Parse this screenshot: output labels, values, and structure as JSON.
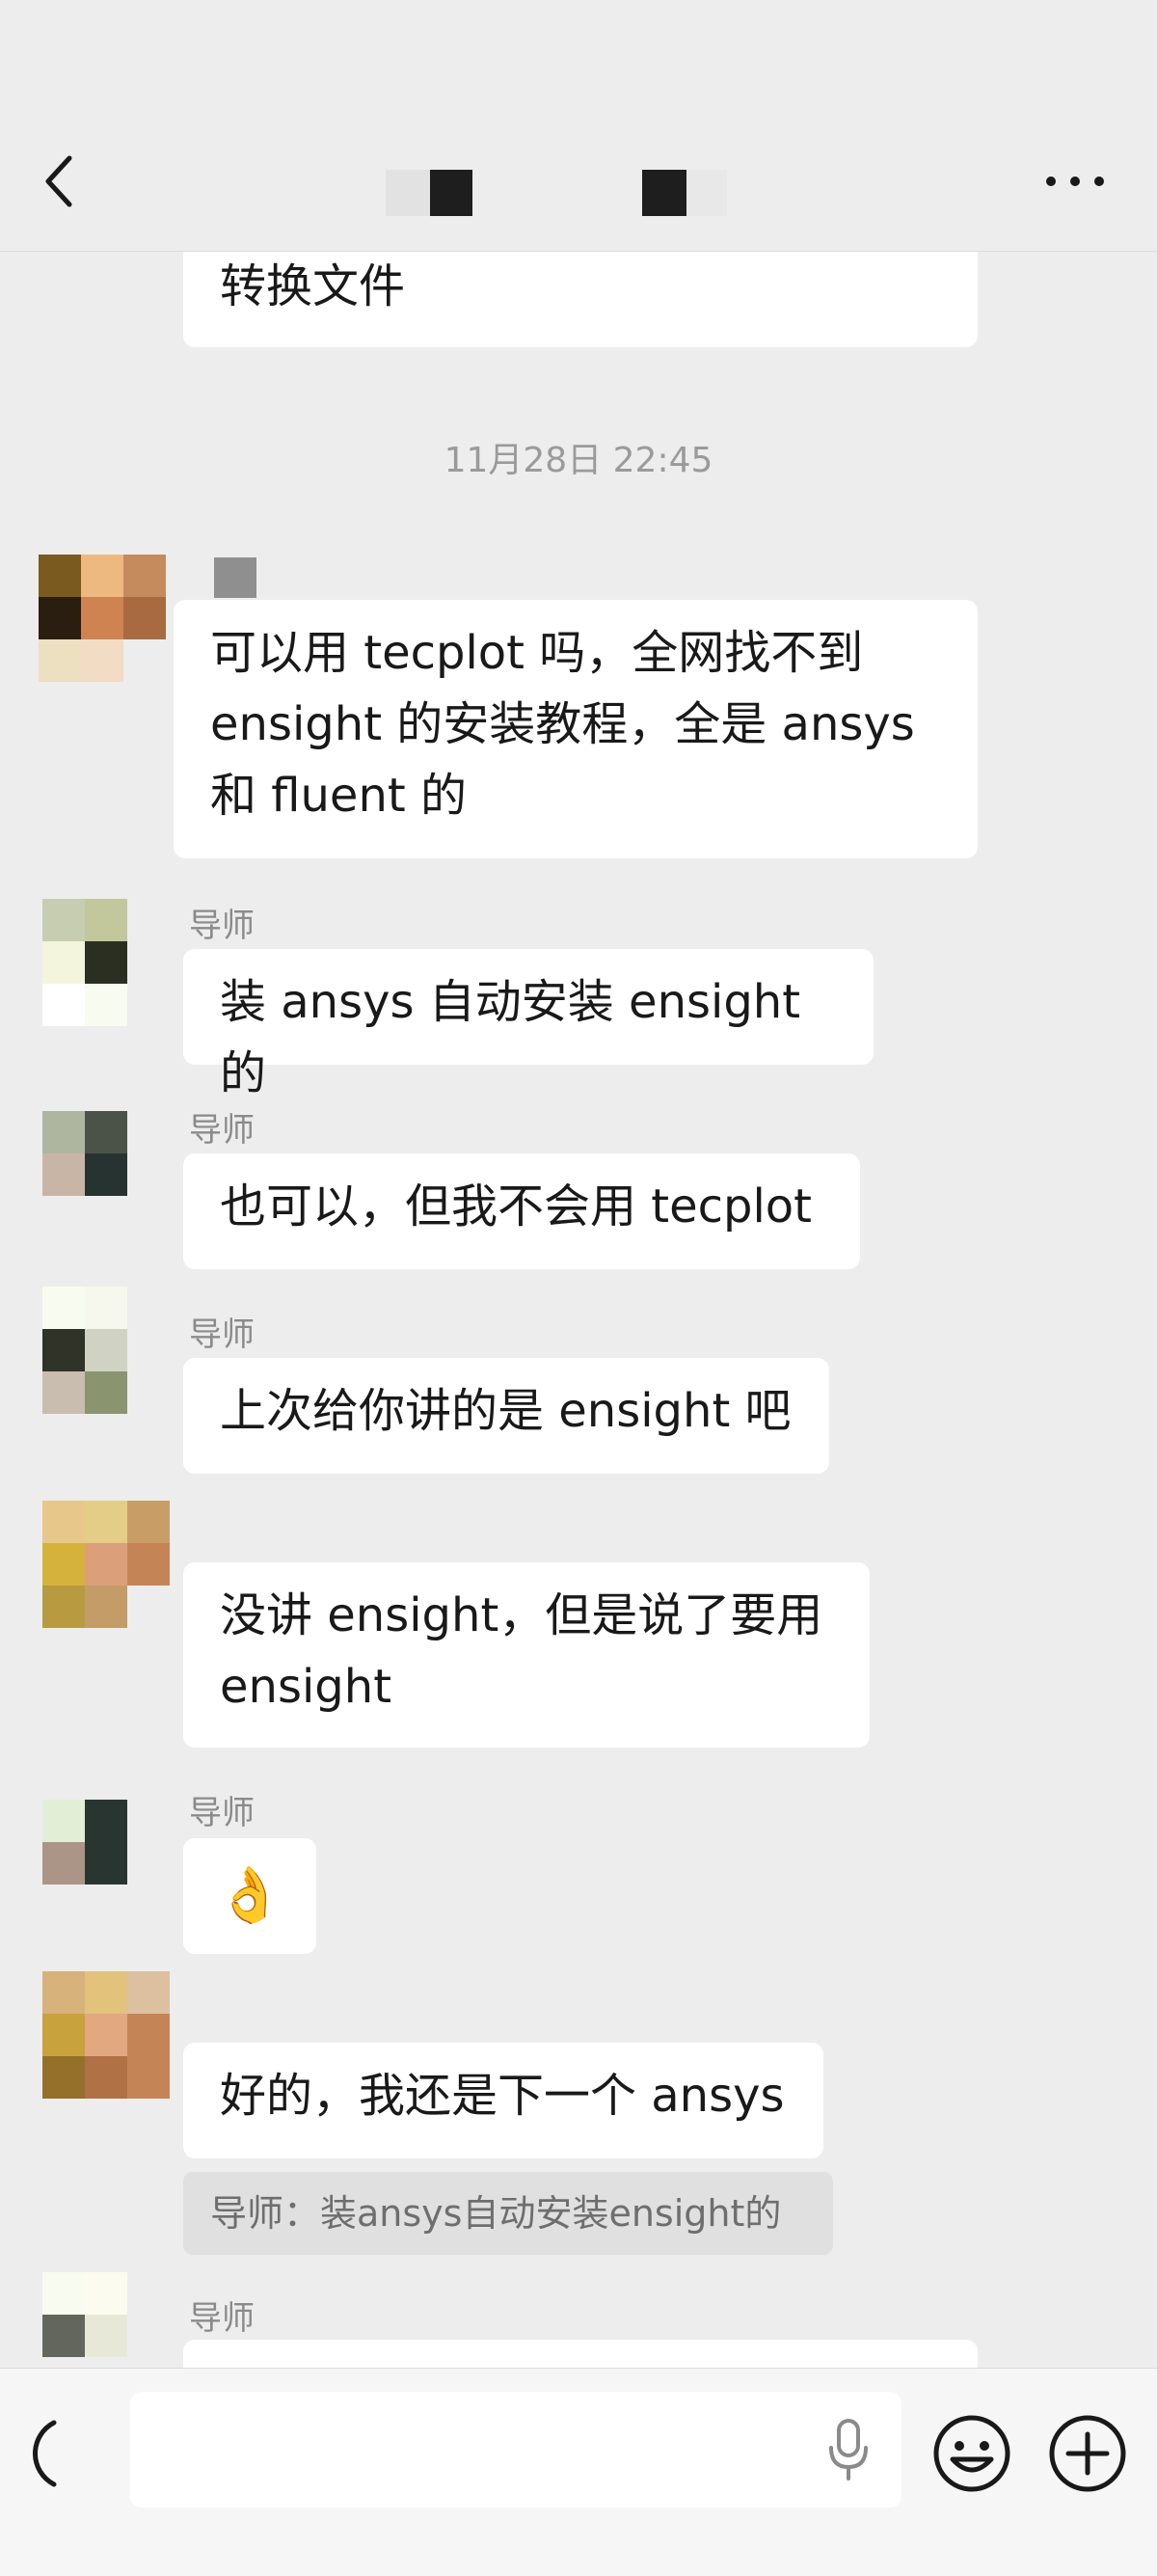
{
  "header": {
    "back_icon": "chevron-left-icon",
    "more_icon": "more-dots-icon"
  },
  "messages": {
    "m0_text": "转换文件",
    "timestamp": "11月28日 22:45",
    "m1_text": "可以用 tecplot 吗，全网找不到\nensight 的安装教程，全是 ansys\n和 fluent 的",
    "m2_name": "导师",
    "m2_text": "装 ansys 自动安装 ensight 的",
    "m3_name": "导师",
    "m3_text": "也可以，但我不会用 tecplot",
    "m4_name": "导师",
    "m4_text": "上次给你讲的是 ensight 吧",
    "m5_text": "没讲 ensight，但是说了要用\nensight",
    "m6_name": "导师",
    "m6_emoji": "👌",
    "m7_text": "好的，我还是下一个 ansys",
    "m7_quote": "导师：装ansys自动安装ensight的",
    "m8_name": "导师"
  },
  "input": {
    "voice_toggle_icon": "voice-toggle-icon",
    "mic_icon": "microphone-icon",
    "emoji_icon": "emoji-icon",
    "plus_icon": "plus-icon"
  },
  "colors": {
    "background": "#ededed",
    "bubble": "#ffffff",
    "timestamp": "#9a9a9a",
    "name": "#8a8a8a"
  }
}
